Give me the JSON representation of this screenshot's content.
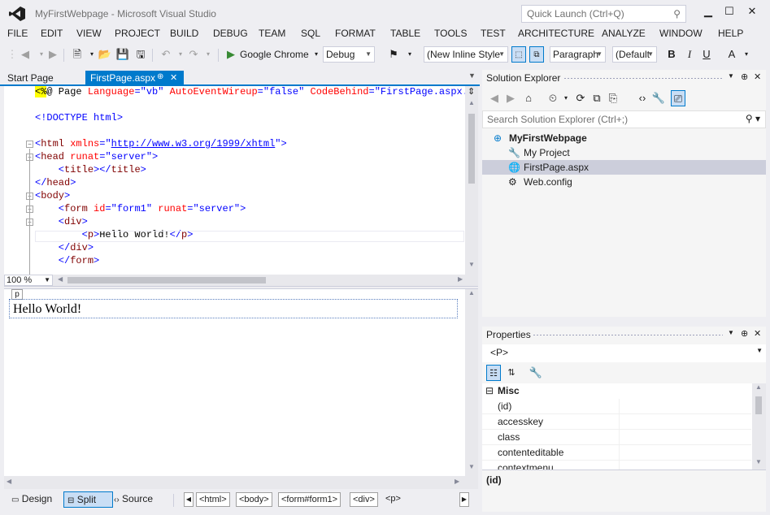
{
  "window": {
    "title": "MyFirstWebpage - Microsoft Visual Studio",
    "quick_launch_placeholder": "Quick Launch (Ctrl+Q)",
    "minimize": "▁",
    "maximize": "☐",
    "close": "✕"
  },
  "menu": [
    "FILE",
    "EDIT",
    "VIEW",
    "PROJECT",
    "BUILD",
    "DEBUG",
    "TEAM",
    "SQL",
    "FORMAT",
    "TABLE",
    "TOOLS",
    "TEST",
    "ARCHITECTURE",
    "ANALYZE",
    "WINDOW",
    "HELP"
  ],
  "toolbar": {
    "run_target": "Google Chrome",
    "configuration": "Debug",
    "style": "(New Inline Style",
    "block_format": "Paragraph",
    "font": "(Default",
    "bold": "B",
    "italic": "I",
    "underline": "U",
    "font_color": "A"
  },
  "tabs": {
    "start_page": "Start Page",
    "active": "FirstPage.aspx",
    "pin": "⊕",
    "close": "✕"
  },
  "code": {
    "lines": [
      {
        "parts": [
          {
            "t": "<%",
            "c": "#000",
            "bg": "#ffff00"
          },
          {
            "t": "@ Page ",
            "c": "#000"
          },
          {
            "t": "Language",
            "c": "#ff0000"
          },
          {
            "t": "=",
            "c": "#0000ff"
          },
          {
            "t": "\"vb\"",
            "c": "#0000ff"
          },
          {
            "t": " AutoEventWireup",
            "c": "#ff0000"
          },
          {
            "t": "=",
            "c": "#0000ff"
          },
          {
            "t": "\"false\"",
            "c": "#0000ff"
          },
          {
            "t": " CodeBehind",
            "c": "#ff0000"
          },
          {
            "t": "=",
            "c": "#0000ff"
          },
          {
            "t": "\"FirstPage.aspx.vb",
            "c": "#0000ff"
          }
        ]
      },
      {
        "parts": []
      },
      {
        "parts": [
          {
            "t": "<!DOCTYPE html>",
            "c": "#0000ff"
          }
        ]
      },
      {
        "parts": []
      },
      {
        "parts": [
          {
            "t": "<",
            "c": "#0000ff"
          },
          {
            "t": "html",
            "c": "#800000"
          },
          {
            "t": " xmlns",
            "c": "#ff0000"
          },
          {
            "t": "=",
            "c": "#0000ff"
          },
          {
            "t": "\"",
            "c": "#0000ff"
          },
          {
            "t": "http://www.w3.org/1999/xhtml",
            "c": "#0000ff",
            "u": true
          },
          {
            "t": "\">",
            "c": "#0000ff"
          }
        ]
      },
      {
        "parts": [
          {
            "t": "<",
            "c": "#0000ff"
          },
          {
            "t": "head",
            "c": "#800000"
          },
          {
            "t": " runat",
            "c": "#ff0000"
          },
          {
            "t": "=",
            "c": "#0000ff"
          },
          {
            "t": "\"server\">",
            "c": "#0000ff"
          }
        ]
      },
      {
        "parts": [
          {
            "t": "    <",
            "c": "#0000ff"
          },
          {
            "t": "title",
            "c": "#800000"
          },
          {
            "t": "></",
            "c": "#0000ff"
          },
          {
            "t": "title",
            "c": "#800000"
          },
          {
            "t": ">",
            "c": "#0000ff"
          }
        ]
      },
      {
        "parts": [
          {
            "t": "</",
            "c": "#0000ff"
          },
          {
            "t": "head",
            "c": "#800000"
          },
          {
            "t": ">",
            "c": "#0000ff"
          }
        ]
      },
      {
        "parts": [
          {
            "t": "<",
            "c": "#0000ff"
          },
          {
            "t": "body",
            "c": "#800000"
          },
          {
            "t": ">",
            "c": "#0000ff"
          }
        ]
      },
      {
        "parts": [
          {
            "t": "    <",
            "c": "#0000ff"
          },
          {
            "t": "form",
            "c": "#800000"
          },
          {
            "t": " id",
            "c": "#ff0000"
          },
          {
            "t": "=",
            "c": "#0000ff"
          },
          {
            "t": "\"form1\"",
            "c": "#0000ff"
          },
          {
            "t": " runat",
            "c": "#ff0000"
          },
          {
            "t": "=",
            "c": "#0000ff"
          },
          {
            "t": "\"server\">",
            "c": "#0000ff"
          }
        ]
      },
      {
        "parts": [
          {
            "t": "    <",
            "c": "#0000ff"
          },
          {
            "t": "div",
            "c": "#800000"
          },
          {
            "t": ">",
            "c": "#0000ff"
          }
        ]
      },
      {
        "parts": [
          {
            "t": "        <",
            "c": "#0000ff"
          },
          {
            "t": "p",
            "c": "#800000"
          },
          {
            "t": ">",
            "c": "#0000ff"
          },
          {
            "t": "Hello World!",
            "c": "#000"
          },
          {
            "t": "</",
            "c": "#0000ff"
          },
          {
            "t": "p",
            "c": "#800000"
          },
          {
            "t": ">",
            "c": "#0000ff"
          }
        ]
      },
      {
        "parts": [
          {
            "t": "    </",
            "c": "#0000ff"
          },
          {
            "t": "div",
            "c": "#800000"
          },
          {
            "t": ">",
            "c": "#0000ff"
          }
        ]
      },
      {
        "parts": [
          {
            "t": "    </",
            "c": "#0000ff"
          },
          {
            "t": "form",
            "c": "#800000"
          },
          {
            "t": ">",
            "c": "#0000ff"
          }
        ]
      }
    ],
    "zoom": "100 %"
  },
  "design": {
    "tag": "p",
    "content": "Hello World!"
  },
  "bottom": {
    "design": "Design",
    "split": "Split",
    "source": "Source",
    "breadcrumbs": [
      "<html>",
      "<body>",
      "<form#form1>",
      "<div>",
      "<p>"
    ]
  },
  "solution_explorer": {
    "title": "Solution Explorer",
    "search_placeholder": "Search Solution Explorer (Ctrl+;)",
    "items": [
      {
        "label": "MyFirstWebpage",
        "bold": true,
        "indent": 0,
        "icon": "globe-project-icon"
      },
      {
        "label": "My Project",
        "bold": false,
        "indent": 1,
        "icon": "wrench-icon"
      },
      {
        "label": "FirstPage.aspx",
        "bold": false,
        "indent": 1,
        "icon": "web-page-icon",
        "selected": true
      },
      {
        "label": "Web.config",
        "bold": false,
        "indent": 1,
        "icon": "config-file-icon"
      }
    ]
  },
  "properties": {
    "title": "Properties",
    "selected_object": "<P>",
    "category": "Misc",
    "rows": [
      "(id)",
      "accesskey",
      "class",
      "contenteditable",
      "contextmenu"
    ],
    "description": "(id)"
  },
  "colors": {
    "accent": "#007acc",
    "chrome": "#eeeef2",
    "selection": "#cccedb"
  }
}
